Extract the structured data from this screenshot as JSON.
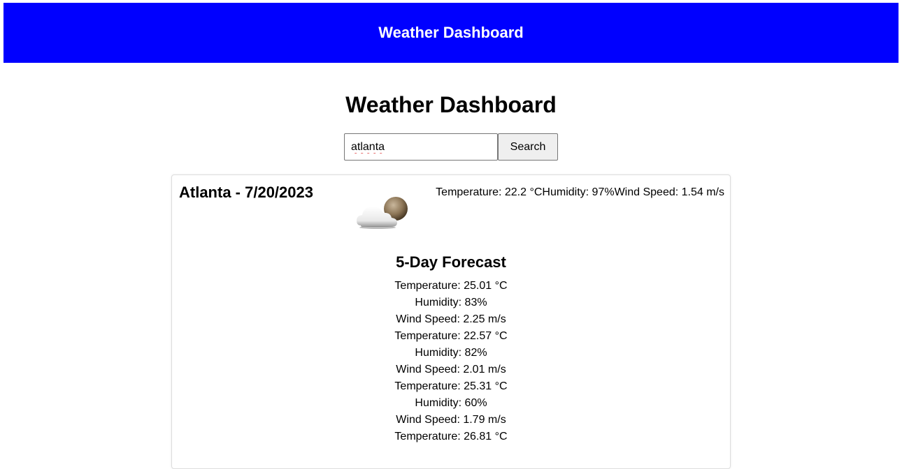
{
  "header": {
    "title": "Weather Dashboard"
  },
  "main": {
    "title": "Weather Dashboard",
    "search": {
      "value": "atlanta",
      "button_label": "Search"
    }
  },
  "current": {
    "heading": "Atlanta - 7/20/2023",
    "icon": "cloud-moon-icon",
    "temperature": "Temperature: 22.2 °C",
    "humidity": "Humidity: 97%",
    "wind": "Wind Speed: 1.54 m/s"
  },
  "forecast": {
    "heading": "5-Day Forecast",
    "days": [
      {
        "temperature": "Temperature: 25.01 °C",
        "humidity": "Humidity: 83%",
        "wind": "Wind Speed: 2.25 m/s"
      },
      {
        "temperature": "Temperature: 22.57 °C",
        "humidity": "Humidity: 82%",
        "wind": "Wind Speed: 2.01 m/s"
      },
      {
        "temperature": "Temperature: 25.31 °C",
        "humidity": "Humidity: 60%",
        "wind": "Wind Speed: 1.79 m/s"
      },
      {
        "temperature": "Temperature: 26.81 °C"
      }
    ]
  },
  "colors": {
    "banner": "#0000ff",
    "banner_text": "#ffffff"
  }
}
